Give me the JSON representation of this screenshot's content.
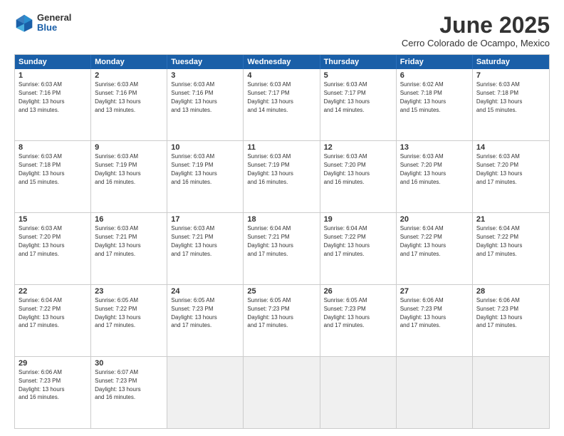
{
  "header": {
    "logo": {
      "general": "General",
      "blue": "Blue"
    },
    "title": "June 2025",
    "location": "Cerro Colorado de Ocampo, Mexico"
  },
  "days_of_week": [
    "Sunday",
    "Monday",
    "Tuesday",
    "Wednesday",
    "Thursday",
    "Friday",
    "Saturday"
  ],
  "rows": [
    [
      {
        "day": "",
        "info": ""
      },
      {
        "day": "2",
        "info": "Sunrise: 6:03 AM\nSunset: 7:16 PM\nDaylight: 13 hours\nand 13 minutes."
      },
      {
        "day": "3",
        "info": "Sunrise: 6:03 AM\nSunset: 7:16 PM\nDaylight: 13 hours\nand 13 minutes."
      },
      {
        "day": "4",
        "info": "Sunrise: 6:03 AM\nSunset: 7:17 PM\nDaylight: 13 hours\nand 14 minutes."
      },
      {
        "day": "5",
        "info": "Sunrise: 6:03 AM\nSunset: 7:17 PM\nDaylight: 13 hours\nand 14 minutes."
      },
      {
        "day": "6",
        "info": "Sunrise: 6:02 AM\nSunset: 7:18 PM\nDaylight: 13 hours\nand 15 minutes."
      },
      {
        "day": "7",
        "info": "Sunrise: 6:03 AM\nSunset: 7:18 PM\nDaylight: 13 hours\nand 15 minutes."
      }
    ],
    [
      {
        "day": "8",
        "info": "Sunrise: 6:03 AM\nSunset: 7:18 PM\nDaylight: 13 hours\nand 15 minutes."
      },
      {
        "day": "9",
        "info": "Sunrise: 6:03 AM\nSunset: 7:19 PM\nDaylight: 13 hours\nand 16 minutes."
      },
      {
        "day": "10",
        "info": "Sunrise: 6:03 AM\nSunset: 7:19 PM\nDaylight: 13 hours\nand 16 minutes."
      },
      {
        "day": "11",
        "info": "Sunrise: 6:03 AM\nSunset: 7:19 PM\nDaylight: 13 hours\nand 16 minutes."
      },
      {
        "day": "12",
        "info": "Sunrise: 6:03 AM\nSunset: 7:20 PM\nDaylight: 13 hours\nand 16 minutes."
      },
      {
        "day": "13",
        "info": "Sunrise: 6:03 AM\nSunset: 7:20 PM\nDaylight: 13 hours\nand 16 minutes."
      },
      {
        "day": "14",
        "info": "Sunrise: 6:03 AM\nSunset: 7:20 PM\nDaylight: 13 hours\nand 17 minutes."
      }
    ],
    [
      {
        "day": "15",
        "info": "Sunrise: 6:03 AM\nSunset: 7:20 PM\nDaylight: 13 hours\nand 17 minutes."
      },
      {
        "day": "16",
        "info": "Sunrise: 6:03 AM\nSunset: 7:21 PM\nDaylight: 13 hours\nand 17 minutes."
      },
      {
        "day": "17",
        "info": "Sunrise: 6:03 AM\nSunset: 7:21 PM\nDaylight: 13 hours\nand 17 minutes."
      },
      {
        "day": "18",
        "info": "Sunrise: 6:04 AM\nSunset: 7:21 PM\nDaylight: 13 hours\nand 17 minutes."
      },
      {
        "day": "19",
        "info": "Sunrise: 6:04 AM\nSunset: 7:22 PM\nDaylight: 13 hours\nand 17 minutes."
      },
      {
        "day": "20",
        "info": "Sunrise: 6:04 AM\nSunset: 7:22 PM\nDaylight: 13 hours\nand 17 minutes."
      },
      {
        "day": "21",
        "info": "Sunrise: 6:04 AM\nSunset: 7:22 PM\nDaylight: 13 hours\nand 17 minutes."
      }
    ],
    [
      {
        "day": "22",
        "info": "Sunrise: 6:04 AM\nSunset: 7:22 PM\nDaylight: 13 hours\nand 17 minutes."
      },
      {
        "day": "23",
        "info": "Sunrise: 6:05 AM\nSunset: 7:22 PM\nDaylight: 13 hours\nand 17 minutes."
      },
      {
        "day": "24",
        "info": "Sunrise: 6:05 AM\nSunset: 7:23 PM\nDaylight: 13 hours\nand 17 minutes."
      },
      {
        "day": "25",
        "info": "Sunrise: 6:05 AM\nSunset: 7:23 PM\nDaylight: 13 hours\nand 17 minutes."
      },
      {
        "day": "26",
        "info": "Sunrise: 6:05 AM\nSunset: 7:23 PM\nDaylight: 13 hours\nand 17 minutes."
      },
      {
        "day": "27",
        "info": "Sunrise: 6:06 AM\nSunset: 7:23 PM\nDaylight: 13 hours\nand 17 minutes."
      },
      {
        "day": "28",
        "info": "Sunrise: 6:06 AM\nSunset: 7:23 PM\nDaylight: 13 hours\nand 17 minutes."
      }
    ],
    [
      {
        "day": "29",
        "info": "Sunrise: 6:06 AM\nSunset: 7:23 PM\nDaylight: 13 hours\nand 16 minutes."
      },
      {
        "day": "30",
        "info": "Sunrise: 6:07 AM\nSunset: 7:23 PM\nDaylight: 13 hours\nand 16 minutes."
      },
      {
        "day": "",
        "info": ""
      },
      {
        "day": "",
        "info": ""
      },
      {
        "day": "",
        "info": ""
      },
      {
        "day": "",
        "info": ""
      },
      {
        "day": "",
        "info": ""
      }
    ]
  ],
  "row1_day1": {
    "day": "1",
    "info": "Sunrise: 6:03 AM\nSunset: 7:16 PM\nDaylight: 13 hours\nand 13 minutes."
  }
}
